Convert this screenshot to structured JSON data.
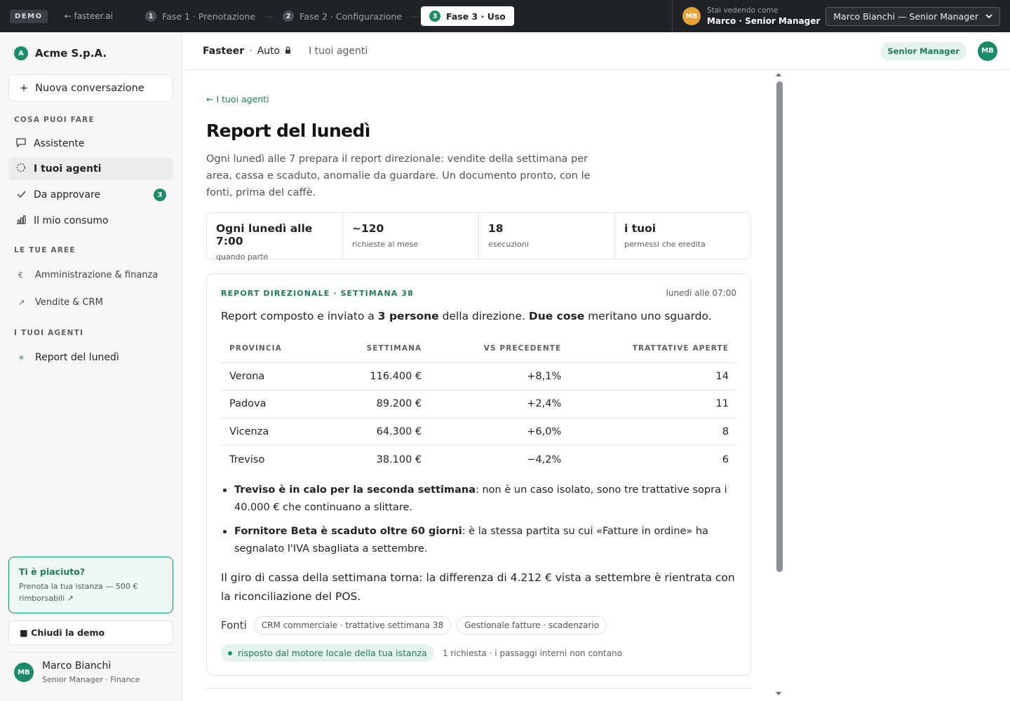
{
  "topbar": {
    "demo_badge": "DEMO",
    "back_link": "← fasteer.ai",
    "steps": [
      {
        "num": "1",
        "label": "Fase 1 · Prenotazione"
      },
      {
        "num": "2",
        "label": "Fase 2 · Configurazione"
      },
      {
        "num": "3",
        "label": "Fase 3 · Uso"
      }
    ],
    "step_separator": "—",
    "viewing_avatar": "MB",
    "viewing_label": "Stai vedendo come",
    "viewing_name": "Marco · Senior Manager",
    "role_select_value": "Marco Bianchi — Senior Manager",
    "role_select_icon": "chevron-down-icon"
  },
  "sidebar": {
    "org_initial": "A",
    "org_name": "Acme S.p.A.",
    "new_chat_icon": "+",
    "new_chat_label": "Nuova conversazione",
    "section_can_do": "COSA PUOI FARE",
    "nav": [
      {
        "icon": "chat-icon",
        "label": "Assistente"
      },
      {
        "icon": "agent-spinner-icon",
        "label": "I tuoi agenti"
      },
      {
        "icon": "check-icon",
        "label": "Da approvare",
        "count": "3"
      },
      {
        "icon": "bar-chart-icon",
        "label": "Il mio consumo"
      }
    ],
    "section_areas": "LE TUE AREE",
    "areas": [
      {
        "icon": "€",
        "label": "Amministrazione & finanza"
      },
      {
        "icon": "↗",
        "label": "Vendite & CRM"
      }
    ],
    "section_agents": "I TUOI AGENTI",
    "agents": [
      {
        "icon": "✳",
        "label": "Report del lunedì"
      }
    ],
    "promo_title": "Ti è piaciuto?",
    "promo_text": "Prenota la tua istanza — 500 € rimborsabili ↗",
    "close_demo": "■ Chiudi la demo",
    "user_initials": "MB",
    "user_name": "Marco Bianchi",
    "user_role": "Senior Manager · Finance"
  },
  "header": {
    "brand": "Fasteer",
    "separator": "·",
    "mode": "Auto",
    "lock_icon": "🔒",
    "agents_link": "I tuoi agenti",
    "role_pill": "Senior Manager",
    "avatar": "MB"
  },
  "main": {
    "back_link": "← I tuoi agenti",
    "title": "Report del lunedì",
    "description": "Ogni lunedì alle 7 prepara il report direzionale: vendite della settimana per area, cassa e scaduto, anomalie da guardare. Un documento pronto, con le fonti, prima del caffè.",
    "stats": [
      {
        "value": "Ogni lunedì alle 7:00",
        "label": "quando parte"
      },
      {
        "value": "~120",
        "label": "richieste al mese"
      },
      {
        "value": "18",
        "label": "esecuzioni"
      },
      {
        "value": "i tuoi",
        "label": "permessi che eredita"
      }
    ],
    "report": {
      "eyebrow": "REPORT DIREZIONALE · SETTIMANA 38",
      "time": "lunedì alle 07:00",
      "intro_1": "Report composto e inviato a ",
      "intro_bold_1": "3 persone",
      "intro_2": " della direzione. ",
      "intro_bold_2": "Due cose",
      "intro_3": " meritano uno sguardo.",
      "columns": [
        "PROVINCIA",
        "SETTIMANA",
        "VS PRECEDENTE",
        "TRATTATIVE APERTE"
      ],
      "rows": [
        [
          "Verona",
          "116.400 €",
          "+8,1%",
          "14"
        ],
        [
          "Padova",
          "89.200 €",
          "+2,4%",
          "11"
        ],
        [
          "Vicenza",
          "64.300 €",
          "+6,0%",
          "8"
        ],
        [
          "Treviso",
          "38.100 €",
          "−4,2%",
          "6"
        ]
      ],
      "bullets": [
        {
          "bold": "Treviso è in calo per la seconda settimana",
          "text": ": non è un caso isolato, sono tre trattative sopra i 40.000 € che continuano a slittare."
        },
        {
          "bold": "Fornitore Beta è scaduto oltre 60 giorni",
          "text": ": è la stessa partita su cui «Fatture in ordine» ha segnalato l'IVA sbagliata a settembre."
        }
      ],
      "summary": "Il giro di cassa della settimana torna: la differenza di 4.212 € vista a settembre è rientrata con la riconciliazione del POS.",
      "sources_label": "Fonti",
      "sources": [
        "CRM commerciale · trattative settimana 38",
        "Gestionale fatture · scadenzario"
      ],
      "engine_label": "risposto dal motore locale della tua istanza",
      "engine_note": "1 richiesta · i passaggi interni non contano"
    }
  },
  "colors": {
    "accent": "#1d8a6a",
    "topbar": "#1f2226",
    "sidebar": "#f7f7f5",
    "avatar_orange": "#e8a23a"
  }
}
